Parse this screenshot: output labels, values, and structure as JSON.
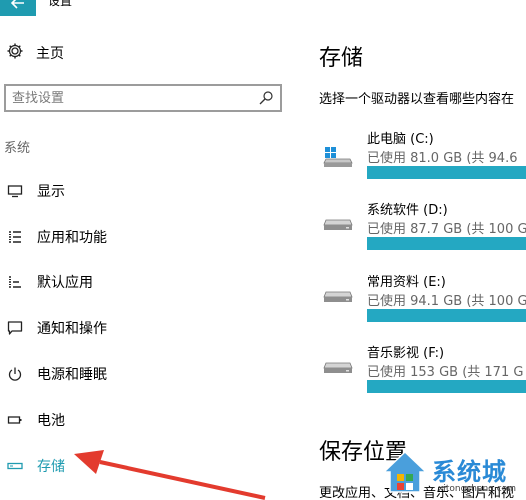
{
  "window": {
    "title": "设置"
  },
  "nav": {
    "home_label": "主页",
    "search_placeholder": "查找设置",
    "section_label": "系统",
    "items": [
      {
        "label": "显示",
        "icon": "monitor-icon"
      },
      {
        "label": "应用和功能",
        "icon": "apps-list-icon"
      },
      {
        "label": "默认应用",
        "icon": "default-apps-icon"
      },
      {
        "label": "通知和操作",
        "icon": "notification-icon"
      },
      {
        "label": "电源和睡眠",
        "icon": "power-icon"
      },
      {
        "label": "电池",
        "icon": "battery-icon"
      },
      {
        "label": "存储",
        "icon": "storage-icon",
        "active": true
      }
    ]
  },
  "main": {
    "title": "存储",
    "description": "选择一个驱动器以查看哪些内容在",
    "drives": [
      {
        "name": "此电脑 (C:)",
        "usage": "已使用 81.0 GB (共 94.6",
        "used_fraction": 0.86,
        "icon": "system-drive-icon"
      },
      {
        "name": "系统软件 (D:)",
        "usage": "已使用 87.7 GB (共 100 G",
        "used_fraction": 0.88,
        "icon": "drive-icon"
      },
      {
        "name": "常用资料 (E:)",
        "usage": "已使用 94.1 GB (共 100 G",
        "used_fraction": 0.94,
        "icon": "drive-icon"
      },
      {
        "name": "音乐影视 (F:)",
        "usage": "已使用 153 GB (共 171 G",
        "used_fraction": 0.89,
        "icon": "drive-icon"
      }
    ],
    "save_location": {
      "title": "保存位置",
      "description": "更改应用、文档、音乐、图片和视"
    }
  },
  "watermark": {
    "text": "系统城",
    "url": "xitongcheng.com"
  },
  "colors": {
    "accent": "#1f9bb0",
    "bar_fill": "#24a8c2",
    "bar_track": "#dcdcdc",
    "arrow": "#e33b2e"
  }
}
